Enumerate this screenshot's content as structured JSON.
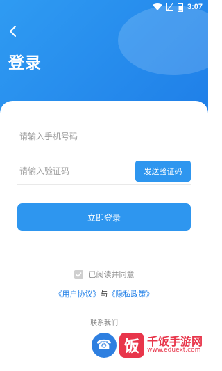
{
  "status_bar": {
    "time": "3:07"
  },
  "header": {
    "title": "登录"
  },
  "form": {
    "phone_placeholder": "请输入手机号码",
    "code_placeholder": "请输入验证码",
    "send_code_label": "发送验证码",
    "login_label": "立即登录"
  },
  "agreement": {
    "checkbox_label": "已阅读并同意",
    "user_agreement": "《用户协议》",
    "conjunction": "与",
    "privacy_policy": "《隐私政策》",
    "contact_label": "联系我们"
  },
  "watermark": {
    "logo_char": "饭",
    "brand": "千饭手游网",
    "url": "www.eduext.com"
  },
  "colors": {
    "primary": "#2e96ef",
    "header_gradient_end": "#1f7fe8",
    "watermark_red": "#e8364b"
  },
  "icons": [
    "wifi-icon",
    "sim-icon",
    "battery-icon",
    "back-arrow-icon",
    "checkmark-icon",
    "phone-icon"
  ]
}
